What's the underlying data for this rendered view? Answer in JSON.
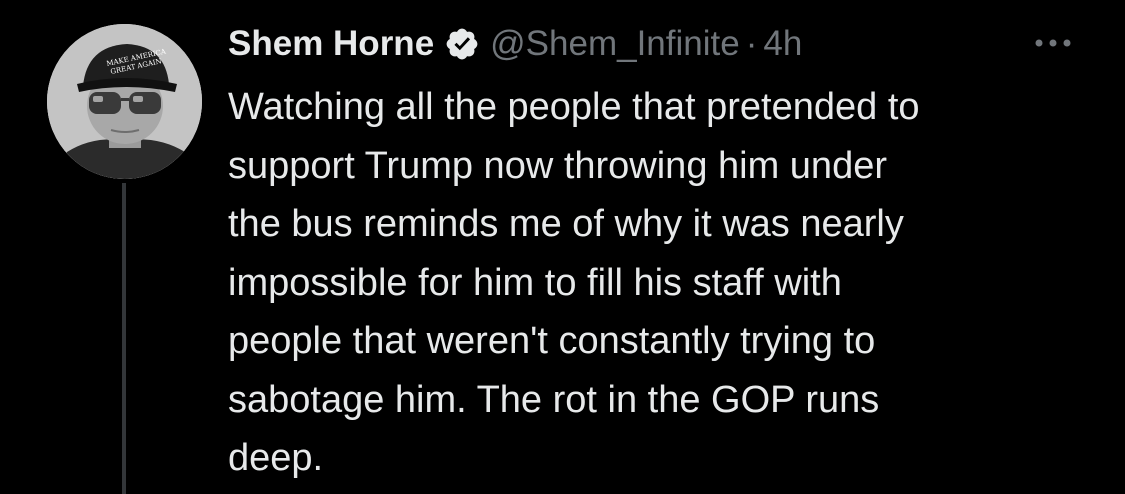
{
  "author": {
    "display_name": "Shem Horne",
    "handle": "@Shem_Infinite",
    "separator": "·",
    "time": "4h",
    "verified": true,
    "avatar_icon": "profile-photo-avatar"
  },
  "tweet": {
    "text": "Watching all the people that pretended to\nsupport Trump now throwing him under\nthe bus reminds me of why it was nearly\nimpossible for him to fill his staff with\npeople that weren't constantly trying to\nsabotage him. The rot in the GOP runs\ndeep."
  },
  "icons": {
    "verified": "verified-badge-icon",
    "more": "more-options-icon"
  },
  "colors": {
    "background": "#000000",
    "primary_text": "#e7e9ea",
    "secondary_text": "#71767b",
    "thread_line": "#333639"
  }
}
